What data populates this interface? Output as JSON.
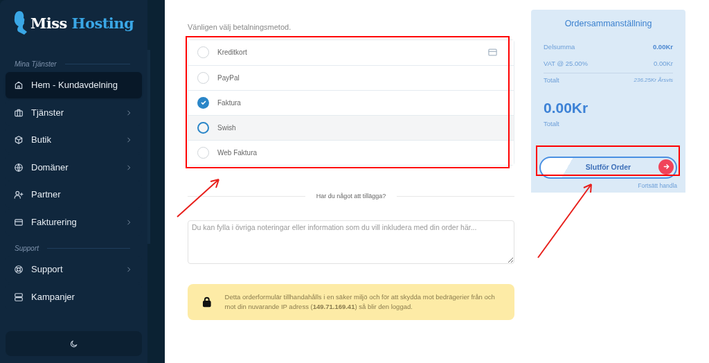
{
  "sidebar": {
    "logo": {
      "first": "Miss",
      "second": "Hosting"
    },
    "sections": [
      {
        "title": "Mina Tjänster",
        "items": [
          {
            "label": "Hem - Kundavdelning",
            "selected": true,
            "has_submenu": false
          },
          {
            "label": "Tjänster",
            "selected": false,
            "has_submenu": true
          },
          {
            "label": "Butik",
            "selected": false,
            "has_submenu": true
          },
          {
            "label": "Domäner",
            "selected": false,
            "has_submenu": true
          },
          {
            "label": "Partner",
            "selected": false,
            "has_submenu": false
          },
          {
            "label": "Fakturering",
            "selected": false,
            "has_submenu": true
          }
        ]
      },
      {
        "title": "Support",
        "items": [
          {
            "label": "Support",
            "selected": false,
            "has_submenu": true
          },
          {
            "label": "Kampanjer",
            "selected": false,
            "has_submenu": false
          }
        ]
      }
    ]
  },
  "payment": {
    "prompt": "Vänligen välj betalningsmetod.",
    "methods": [
      {
        "label": "Kreditkort",
        "selected": false,
        "hovered": false,
        "card_icon": true
      },
      {
        "label": "PayPal",
        "selected": false,
        "hovered": false,
        "card_icon": false
      },
      {
        "label": "Faktura",
        "selected": true,
        "hovered": false,
        "card_icon": false
      },
      {
        "label": "Swish",
        "selected": false,
        "hovered": true,
        "card_icon": false
      },
      {
        "label": "Web Faktura",
        "selected": false,
        "hovered": false,
        "card_icon": false
      }
    ]
  },
  "notes": {
    "heading": "Har du något att tillägga?",
    "placeholder": "Du kan fylla i övriga noteringar eller information som du vill inkludera med din order här..."
  },
  "security_notice": "Detta orderformulär tillhandahålls i en säker miljö och för att skydda mot bedrägerier från och mot din nuvarande IP adress (**149.71.169.41**) så blir den loggad.",
  "summary": {
    "title": "Ordersammanställning",
    "lines": [
      {
        "label": "Delsumma",
        "value": "0.00Kr",
        "bold": true
      },
      {
        "label": "VAT @ 25.00%",
        "value": "0.00Kr",
        "bold": false
      }
    ],
    "total_label": "Totalt",
    "total_recurring": "236.25Kr Årsvis",
    "total": "0.00Kr",
    "total_caption": "Totalt",
    "checkout_button": "Slutför Order",
    "continue_link": "Fortsätt handla"
  }
}
